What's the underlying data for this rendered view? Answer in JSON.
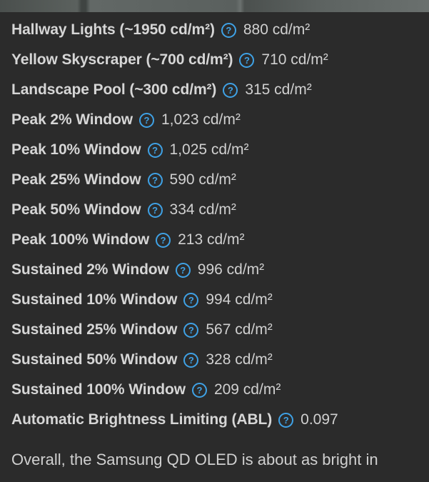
{
  "measurements": [
    {
      "label": "Hallway Lights (~1950 cd/m²)",
      "value": "880 cd/m²"
    },
    {
      "label": "Yellow Skyscraper (~700 cd/m²)",
      "value": "710 cd/m²"
    },
    {
      "label": "Landscape Pool (~300 cd/m²)",
      "value": "315 cd/m²"
    },
    {
      "label": "Peak 2% Window",
      "value": "1,023 cd/m²"
    },
    {
      "label": "Peak 10% Window",
      "value": "1,025 cd/m²"
    },
    {
      "label": "Peak 25% Window",
      "value": "590 cd/m²"
    },
    {
      "label": "Peak 50% Window",
      "value": "334 cd/m²"
    },
    {
      "label": "Peak 100% Window",
      "value": "213 cd/m²"
    },
    {
      "label": "Sustained 2% Window",
      "value": "996 cd/m²"
    },
    {
      "label": "Sustained 10% Window",
      "value": "994 cd/m²"
    },
    {
      "label": "Sustained 25% Window",
      "value": "567 cd/m²"
    },
    {
      "label": "Sustained 50% Window",
      "value": "328 cd/m²"
    },
    {
      "label": "Sustained 100% Window",
      "value": "209 cd/m²"
    },
    {
      "label": "Automatic Brightness Limiting (ABL)",
      "value": "0.097"
    }
  ],
  "help_icon": {
    "glyph": "?",
    "name": "help-icon",
    "color": "#3fa2e6"
  },
  "paragraph": {
    "text": "Overall, the Samsung QD OLED is about as bright in"
  },
  "colors": {
    "background": "#2b2b2b",
    "label": "#d6d6d6",
    "value": "#d0d0d0",
    "accent": "#3fa2e6"
  }
}
